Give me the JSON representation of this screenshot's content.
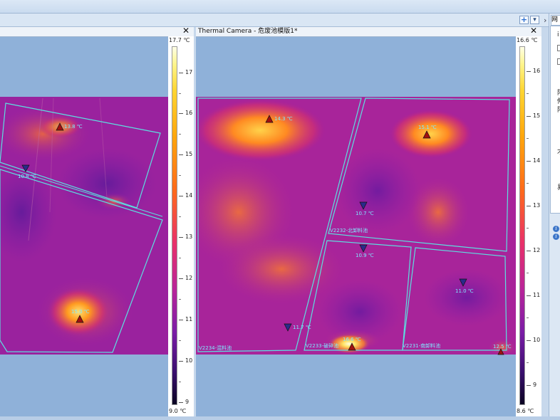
{
  "left_pane": {
    "close": "✕",
    "scale": {
      "max": "17.7 ℃",
      "min": "9.0 ℃",
      "ticks": [
        "17",
        "16",
        "15",
        "14",
        "13",
        "12",
        "11",
        "10",
        "9"
      ]
    },
    "hotspots": [
      {
        "label": "13.8 ℃"
      },
      {
        "label": "15.0 ℃"
      }
    ],
    "coldspots": [
      {
        "label": "10.8 ℃"
      }
    ]
  },
  "right_pane": {
    "title": "Thermal Camera - 危废池模版1*",
    "close": "✕",
    "scale": {
      "max": "16.6 ℃",
      "min": "8.6 ℃",
      "ticks": [
        "16",
        "15",
        "14",
        "13",
        "12",
        "11",
        "10",
        "9"
      ]
    },
    "regions": [
      {
        "name": "V2234-混料池"
      },
      {
        "name": "V2232-北卸料池"
      },
      {
        "name": "V2233-破碎池"
      },
      {
        "name": "V2231-南卸料池"
      }
    ],
    "hotspots": [
      {
        "label": "14.3 ℃"
      },
      {
        "label": "15.1 ℃"
      },
      {
        "label": "16.6 ℃"
      },
      {
        "label": "12.5 ℃"
      }
    ],
    "coldspots": [
      {
        "label": "10.7 ℃"
      },
      {
        "label": "10.9 ℃"
      },
      {
        "label": "11.0 ℃"
      },
      {
        "label": "11.7 ℃"
      }
    ]
  },
  "right_panel": {
    "tab_label": "网",
    "chars": [
      "i",
      "阳",
      "伸",
      "阳",
      "才",
      "易"
    ]
  },
  "colors": {
    "region_outline": "#5ce0e0",
    "label_cyan": "#7fe8ff",
    "hot_marker": "#a01010",
    "cold_marker": "#2a2a8a",
    "pane_bg": "#8fb1d9"
  }
}
